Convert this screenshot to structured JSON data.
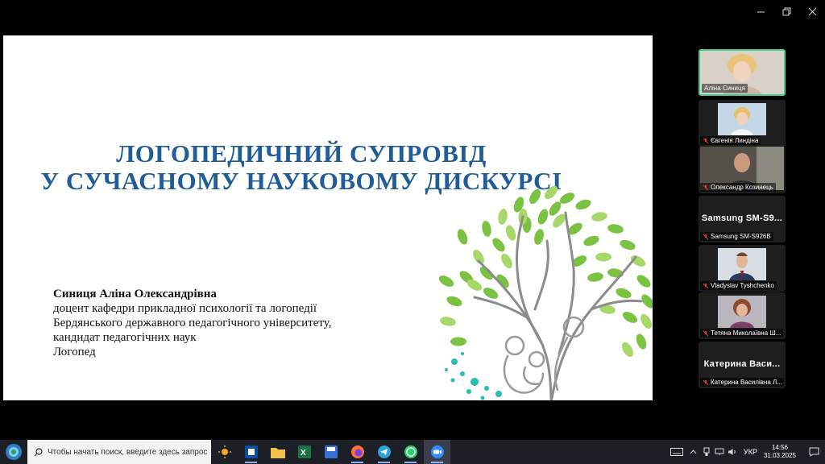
{
  "slide": {
    "title_line1": "ЛОГОПЕДИЧНИЙ СУПРОВІД",
    "title_line2": "У СУЧАСНОМУ НАУКОВОМУ ДИСКУРСІ",
    "author_name": "Синиця Аліна Олександрівна",
    "author_lines": [
      "доцент кафедри прикладної психології та логопедії",
      "Бердянського державного педагогічного університету,",
      "кандидат педагогічних наук",
      "Логопед"
    ]
  },
  "participants": [
    {
      "label": "Аліна Синиця",
      "active": true,
      "muted": false
    },
    {
      "label": "Євгенія Линдіна",
      "muted": true
    },
    {
      "label": "Олександр Козинець",
      "muted": true
    },
    {
      "big_name": "Samsung  SM-S9...",
      "label": "Samsung SM-S926B",
      "muted": true
    },
    {
      "label": "Vladyslav Tyshchenko",
      "muted": true
    },
    {
      "label": "Тетяна Миколаївна Ш...",
      "muted": true
    },
    {
      "big_name": "Катерина  Васи...",
      "label": "Катерина Василівна Л...",
      "muted": true
    }
  ],
  "taskbar": {
    "search_placeholder": "Чтобы начать поиск, введите здесь запрос",
    "apps": [
      "weather-app",
      "app-blue-square",
      "file-explorer",
      "excel",
      "disk-app",
      "firefox",
      "telegram",
      "whatsapp",
      "zoom"
    ],
    "language": "УКР",
    "time": "14:56",
    "date": "31.03.2025"
  },
  "colors": {
    "title_blue": "#1f5c99",
    "active_border": "#3fcf8e",
    "leaf_green": "#7cc242",
    "trunk_grey": "#8c8c8c",
    "dot_teal": "#2bbcb3"
  }
}
